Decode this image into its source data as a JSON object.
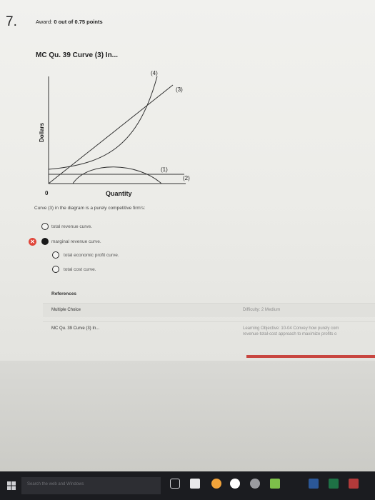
{
  "question": {
    "number": "7.",
    "award_prefix": "Award:",
    "award_value": "0 out of 0.75 points",
    "title": "MC Qu. 39 Curve (3) In..."
  },
  "diagram": {
    "y_axis_label": "Dollars",
    "x_axis_label": "Quantity",
    "origin_label": "0",
    "curve_labels": [
      "(4)",
      "(3)",
      "(1)",
      "(2)"
    ]
  },
  "prompt": "Curve (3) in the diagram is a purely competitive firm's:",
  "options": [
    {
      "label": "total revenue curve.",
      "selected": false,
      "marked_wrong": false
    },
    {
      "label": "marginal revenue curve.",
      "selected": true,
      "marked_wrong": true
    },
    {
      "label": "total economic profit curve.",
      "selected": false,
      "marked_wrong": false
    },
    {
      "label": "total cost curve.",
      "selected": false,
      "marked_wrong": false
    }
  ],
  "references": {
    "heading": "References",
    "rows": [
      {
        "left": "Multiple Choice",
        "right1": "Difficulty: 2 Medium",
        "right2": ""
      },
      {
        "left": "MC Qu. 39 Curve (3) In...",
        "right1": "Learning Objective: 10-04 Convey how purely com",
        "right2": "revenue-total-cost approach to maximize profits o"
      }
    ]
  },
  "taskbar": {
    "search_placeholder": "Search the web and Windows",
    "icons": [
      "task-view-icon",
      "store-icon",
      "edge-icon",
      "chrome-icon",
      "settings-icon",
      "media-icon",
      "word-icon",
      "excel-icon",
      "app-icon"
    ],
    "icon_colors": [
      "#cfd0d4",
      "#e8e8ea",
      "#f2a33a",
      "#ffffff",
      "#9a9ba0",
      "#7dbf4a",
      "#2b5797",
      "#1e7145",
      "#b23a3a"
    ]
  },
  "colors": {
    "wrong_mark": "#e0463a",
    "accent_bar": "#c84640"
  }
}
